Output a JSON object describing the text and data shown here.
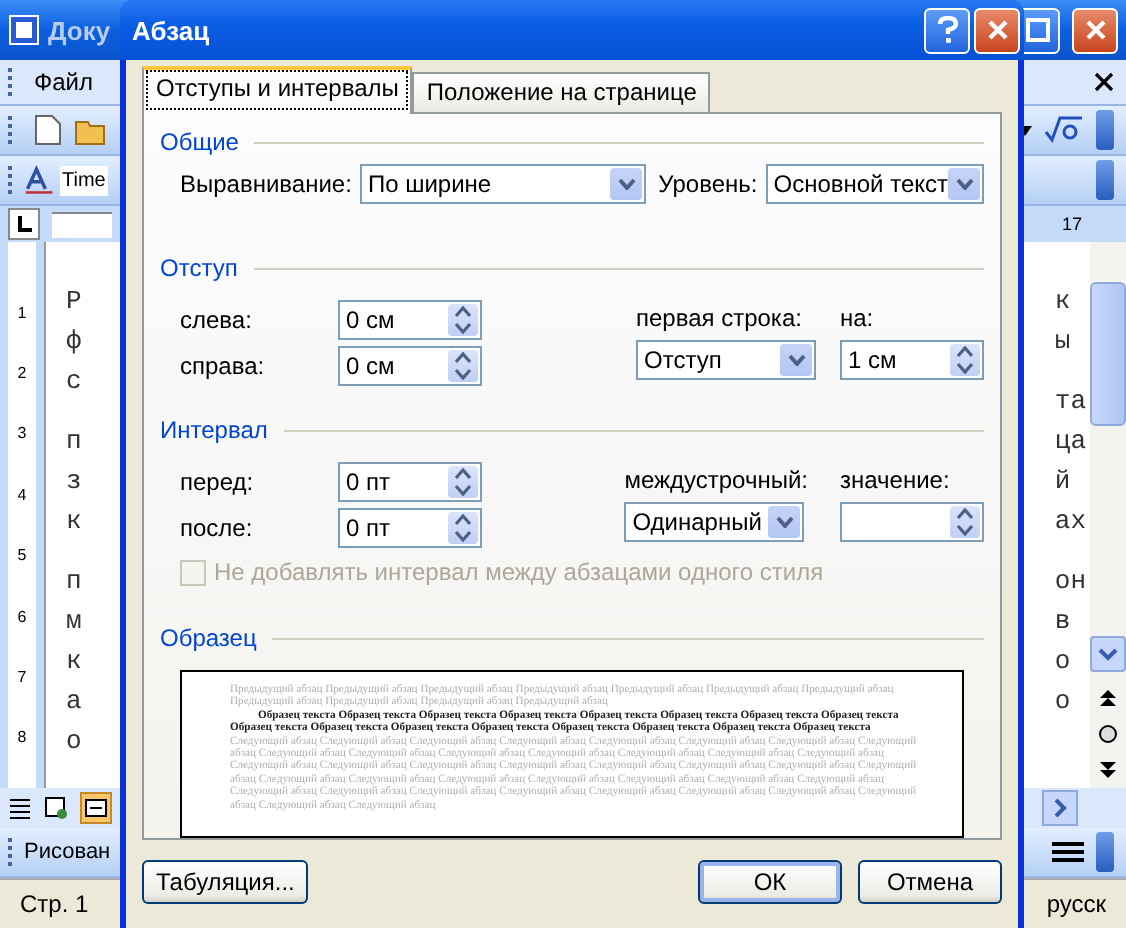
{
  "background_window": {
    "title": "Доку",
    "menu": [
      "Файл"
    ],
    "font_field": "Time",
    "ruler_mark": "17",
    "ruler_numbers": [
      "1",
      "2",
      "3",
      "4",
      "5",
      "6",
      "7",
      "8"
    ],
    "doc_left": [
      [
        "Р",
        "ф",
        "с"
      ],
      [
        "п",
        "з",
        "к"
      ],
      [
        "п",
        "м",
        "к",
        "а",
        "о"
      ]
    ],
    "doc_right": [
      [
        "к",
        "ы"
      ],
      [
        "та",
        "ца",
        "й",
        "ах"
      ],
      [
        "он",
        "в",
        "о",
        "о"
      ]
    ],
    "drawing_toolbar": "Рисован",
    "status_page": "Стр. 1",
    "status_lang": "русск"
  },
  "dialog": {
    "title": "Абзац",
    "tabs": [
      {
        "label": "Отступы и интервалы",
        "selected": true
      },
      {
        "label": "Положение на странице",
        "selected": false
      }
    ],
    "general": {
      "title": "Общие",
      "alignment": {
        "label": "Выравнивание:",
        "value": "По ширине"
      },
      "level": {
        "label": "Уровень:",
        "value": "Основной текст"
      }
    },
    "indent": {
      "title": "Отступ",
      "left": {
        "label": "слева:",
        "value": "0 см"
      },
      "right": {
        "label": "справа:",
        "value": "0 см"
      },
      "first_line": {
        "label": "первая строка:",
        "value": "Отступ"
      },
      "by": {
        "label": "на:",
        "value": "1 см"
      }
    },
    "spacing": {
      "title": "Интервал",
      "before": {
        "label": "перед:",
        "value": "0 пт"
      },
      "after": {
        "label": "после:",
        "value": "0 пт"
      },
      "line": {
        "label": "междустрочный:",
        "value": "Одинарный"
      },
      "at": {
        "label": "значение:"
      },
      "no_space_option": {
        "label": "Не добавлять интервал между абзацами одного стиля",
        "checked": false,
        "disabled": true
      }
    },
    "preview": {
      "title": "Образец",
      "previous": "Предыдущий абзац Предыдущий абзац Предыдущий абзац Предыдущий абзац Предыдущий абзац Предыдущий абзац Предыдущий абзац Предыдущий абзац Предыдущий абзац Предыдущий абзац Предыдущий абзац",
      "sample": "Образец текста Образец текста Образец текста Образец текста Образец текста Образец текста Образец текста Образец текста Образец текста Образец текста Образец текста Образец текста Образец текста Образец текста Образец текста Образец текста",
      "next": "Следующий абзац Следующий абзац Следующий абзац Следующий абзац Следующий абзац Следующий абзац Следующий абзац Следующий абзац Следующий абзац Следующий абзац Следующий абзац Следующий абзац Следующий абзац Следующий абзац Следующий абзац Следующий абзац Следующий абзац Следующий абзац Следующий абзац Следующий абзац Следующий абзац Следующий абзац Следующий абзац Следующий абзац Следующий абзац Следующий абзац Следующий абзац Следующий абзац Следующий абзац Следующий абзац Следующий абзац Следующий абзац Следующий абзац Следующий абзац Следующий абзац Следующий абзац Следующий абзац Следующий абзац Следующий абзац Следующий абзац"
    },
    "buttons": [
      {
        "label": "Табуляция...",
        "default": false
      },
      {
        "label": "ОК",
        "default": true
      },
      {
        "label": "Отмена",
        "default": false
      }
    ]
  }
}
